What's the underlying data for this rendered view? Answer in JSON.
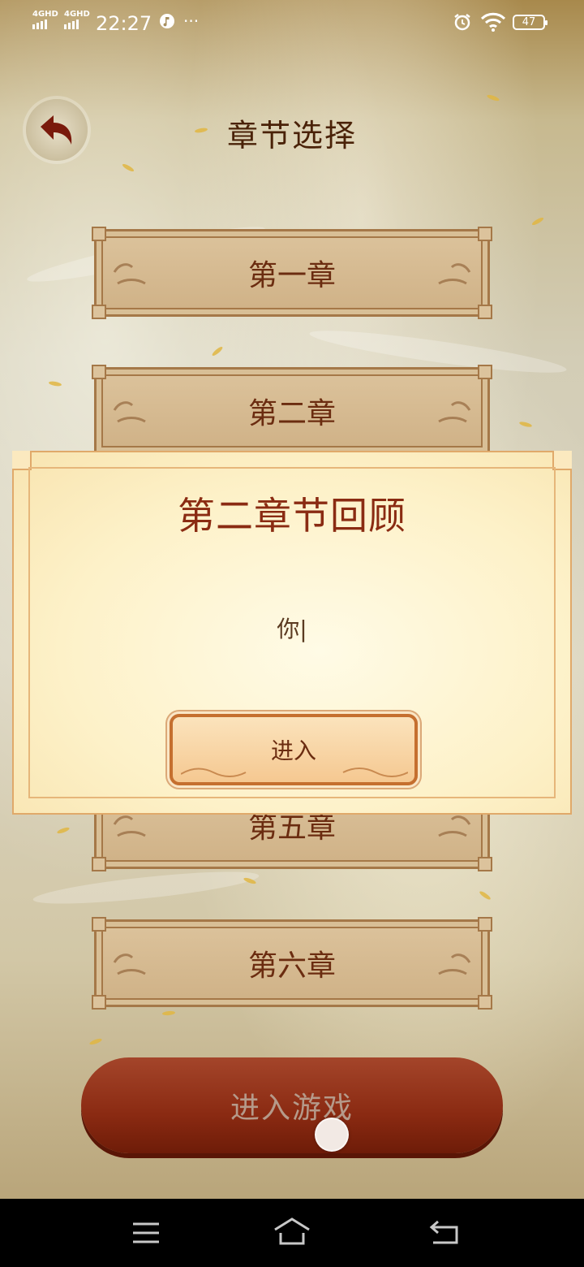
{
  "status_bar": {
    "sim1": "4GHD",
    "sim2": "4GHD",
    "time": "22:27",
    "more": "···",
    "battery": "47",
    "icons": [
      "music-icon",
      "alarm-icon",
      "wifi-icon",
      "battery-icon"
    ]
  },
  "header": {
    "title": "章节选择",
    "back_icon": "back-arrow-icon"
  },
  "chapters": [
    {
      "label": "第一章"
    },
    {
      "label": "第二章"
    },
    {
      "label": "第五章"
    },
    {
      "label": "第六章"
    }
  ],
  "modal": {
    "title": "第二章节回顾",
    "text": "你|",
    "button_label": "进入"
  },
  "start_button": {
    "label": "进入游戏"
  },
  "nav_bar": {
    "icons": [
      "menu-icon",
      "home-icon",
      "back-icon"
    ]
  },
  "colors": {
    "title_brown": "#4a2208",
    "modal_title_red": "#8a2b12",
    "cta_red": "#8a2a12"
  }
}
